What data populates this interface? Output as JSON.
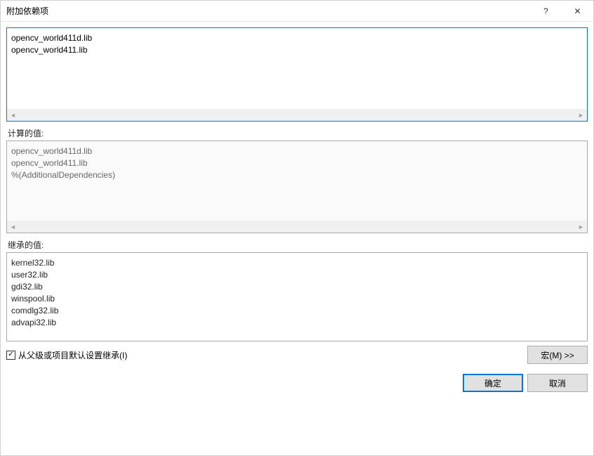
{
  "window": {
    "title": "附加依赖项",
    "help_icon": "?",
    "close_icon": "✕"
  },
  "editable": {
    "content": "opencv_world411d.lib\nopencv_world411.lib"
  },
  "computed": {
    "label": "计算的值:",
    "content": "opencv_world411d.lib\nopencv_world411.lib\n%(AdditionalDependencies)"
  },
  "inherited": {
    "label": "继承的值:",
    "content": "kernel32.lib\nuser32.lib\ngdi32.lib\nwinspool.lib\ncomdlg32.lib\nadvapi32.lib"
  },
  "inherit_check": {
    "label": "从父级或项目默认设置继承(I)",
    "checked": true,
    "mark": "✓"
  },
  "buttons": {
    "macro": "宏(M) >>",
    "ok": "确定",
    "cancel": "取消"
  }
}
